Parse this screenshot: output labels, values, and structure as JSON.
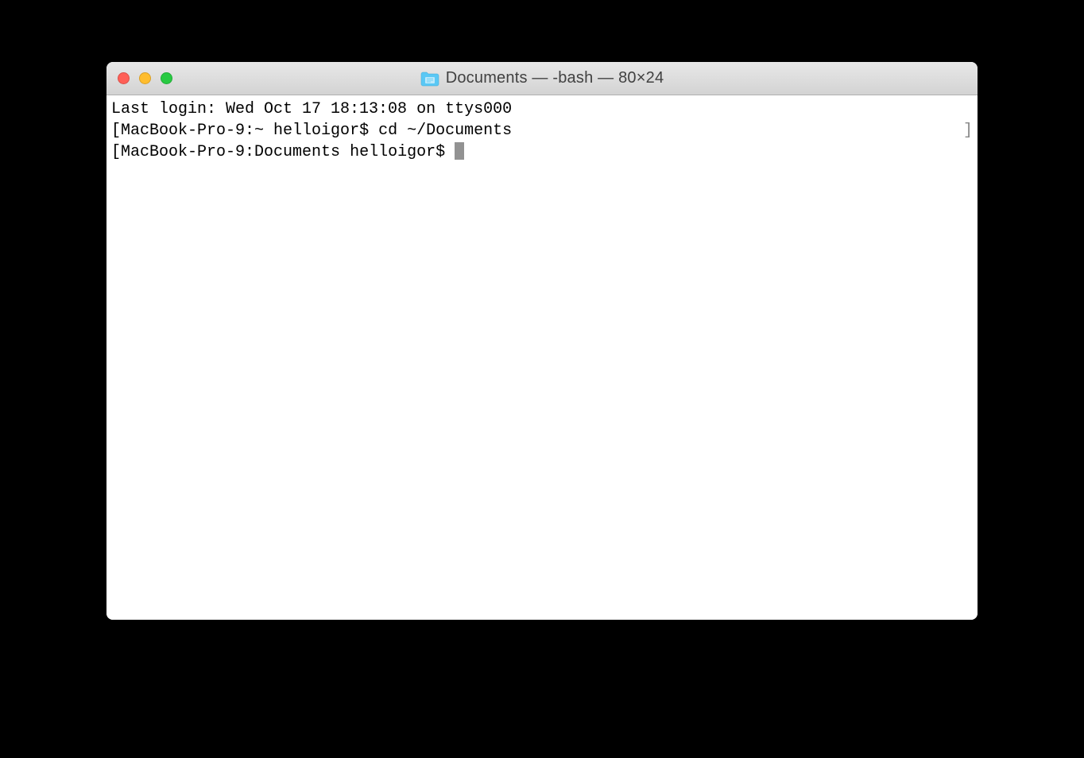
{
  "window": {
    "title": "Documents — -bash — 80×24"
  },
  "terminal": {
    "line1": "Last login: Wed Oct 17 18:13:08 on ttys000",
    "line2_prompt": "MacBook-Pro-9:~ helloigor$ ",
    "line2_command": "cd ~/Documents",
    "line3_prompt": "MacBook-Pro-9:Documents helloigor$ "
  }
}
